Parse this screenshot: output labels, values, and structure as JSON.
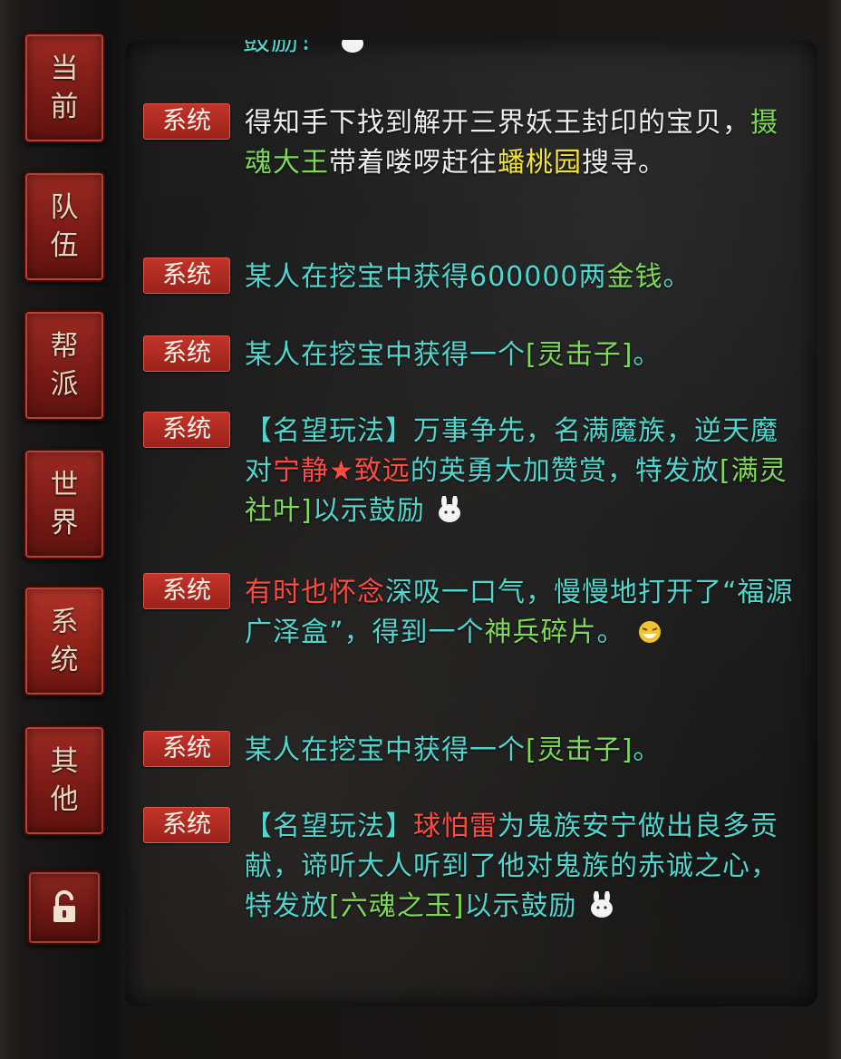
{
  "tabs": [
    {
      "label_top": "当",
      "label_bottom": "前"
    },
    {
      "label_top": "队",
      "label_bottom": "伍"
    },
    {
      "label_top": "帮",
      "label_bottom": "派"
    },
    {
      "label_top": "世",
      "label_bottom": "界"
    },
    {
      "label_top": "系",
      "label_bottom": "统"
    },
    {
      "label_top": "其",
      "label_bottom": "他"
    }
  ],
  "lock_icon": "unlock-icon",
  "colors": {
    "cyan": "#4fd6cf",
    "green": "#7ed957",
    "yellow": "#f2e23a",
    "red": "#ff4b40",
    "badge": "#b52c23"
  },
  "top_fragment": "鼓励！",
  "messages": [
    {
      "badge": "系统",
      "parts": [
        "得知手下找到解开三界妖王封印的宝贝，",
        "摄魂大王",
        "带着喽啰赶往",
        "蟠桃园",
        "搜寻。"
      ]
    },
    {
      "badge": "系统",
      "parts": [
        "某人在挖宝中获得600000两",
        "金钱",
        "。"
      ]
    },
    {
      "badge": "系统",
      "parts": [
        "某人在挖宝中获得一个",
        "[灵击子]",
        "。"
      ]
    },
    {
      "badge": "系统",
      "parts": [
        "【名望玩法】万事争先，名满魔族，逆天魔对",
        "宁静★致远",
        "的英勇大加赞赏，特发放",
        "[满灵社叶]",
        "以示鼓励"
      ]
    },
    {
      "badge": "系统",
      "parts": [
        "有时也怀念",
        "深吸一口气，慢慢地打开了“福源广泽盒”，得到一个",
        "神兵碎片",
        "。"
      ]
    },
    {
      "badge": "系统",
      "parts": [
        "某人在挖宝中获得一个",
        "[灵击子]",
        "。"
      ]
    },
    {
      "badge": "系统",
      "parts": [
        "【名望玩法】",
        "球怕雷",
        "为鬼族安宁做出良多贡献，谛听大人听到了他对鬼族的赤诚之心，特发放",
        "[六魂之玉]",
        "以示鼓励"
      ]
    }
  ]
}
